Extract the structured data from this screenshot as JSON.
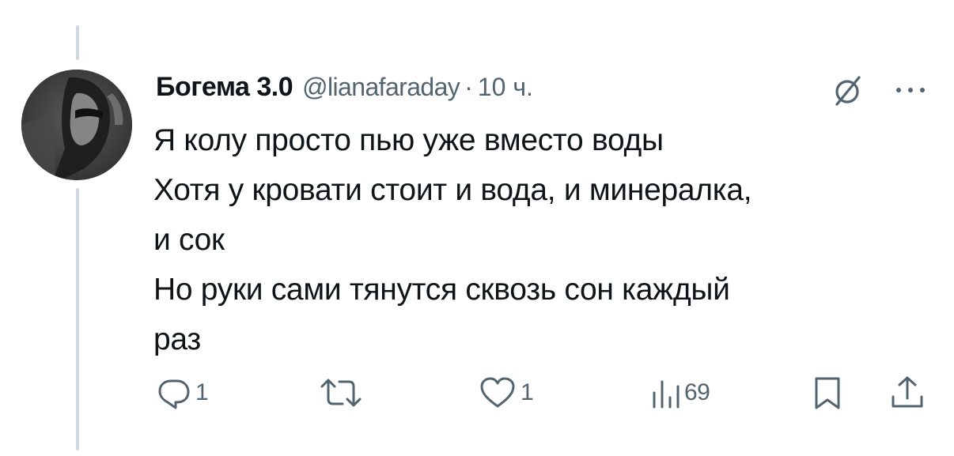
{
  "tweet": {
    "author": {
      "display_name": "Богема 3.0",
      "handle": "@lianafaraday"
    },
    "separator": "·",
    "time": "10 ч.",
    "text_lines": [
      "Я колу просто пью уже вместо воды",
      "Хотя у кровати стоит и вода, и минералка,",
      "и сок",
      "Но руки сами тянутся сквозь сон каждый",
      "раз"
    ],
    "actions": {
      "replies": "1",
      "retweets": "",
      "likes": "1",
      "views": "69"
    }
  },
  "colors": {
    "text_primary": "#0f1419",
    "text_secondary": "#536471",
    "thread_line": "#cfd9de",
    "background": "#ffffff"
  },
  "icons": [
    "grok-icon",
    "more-icon",
    "reply-icon",
    "retweet-icon",
    "like-icon",
    "views-icon",
    "bookmark-icon",
    "share-icon"
  ]
}
